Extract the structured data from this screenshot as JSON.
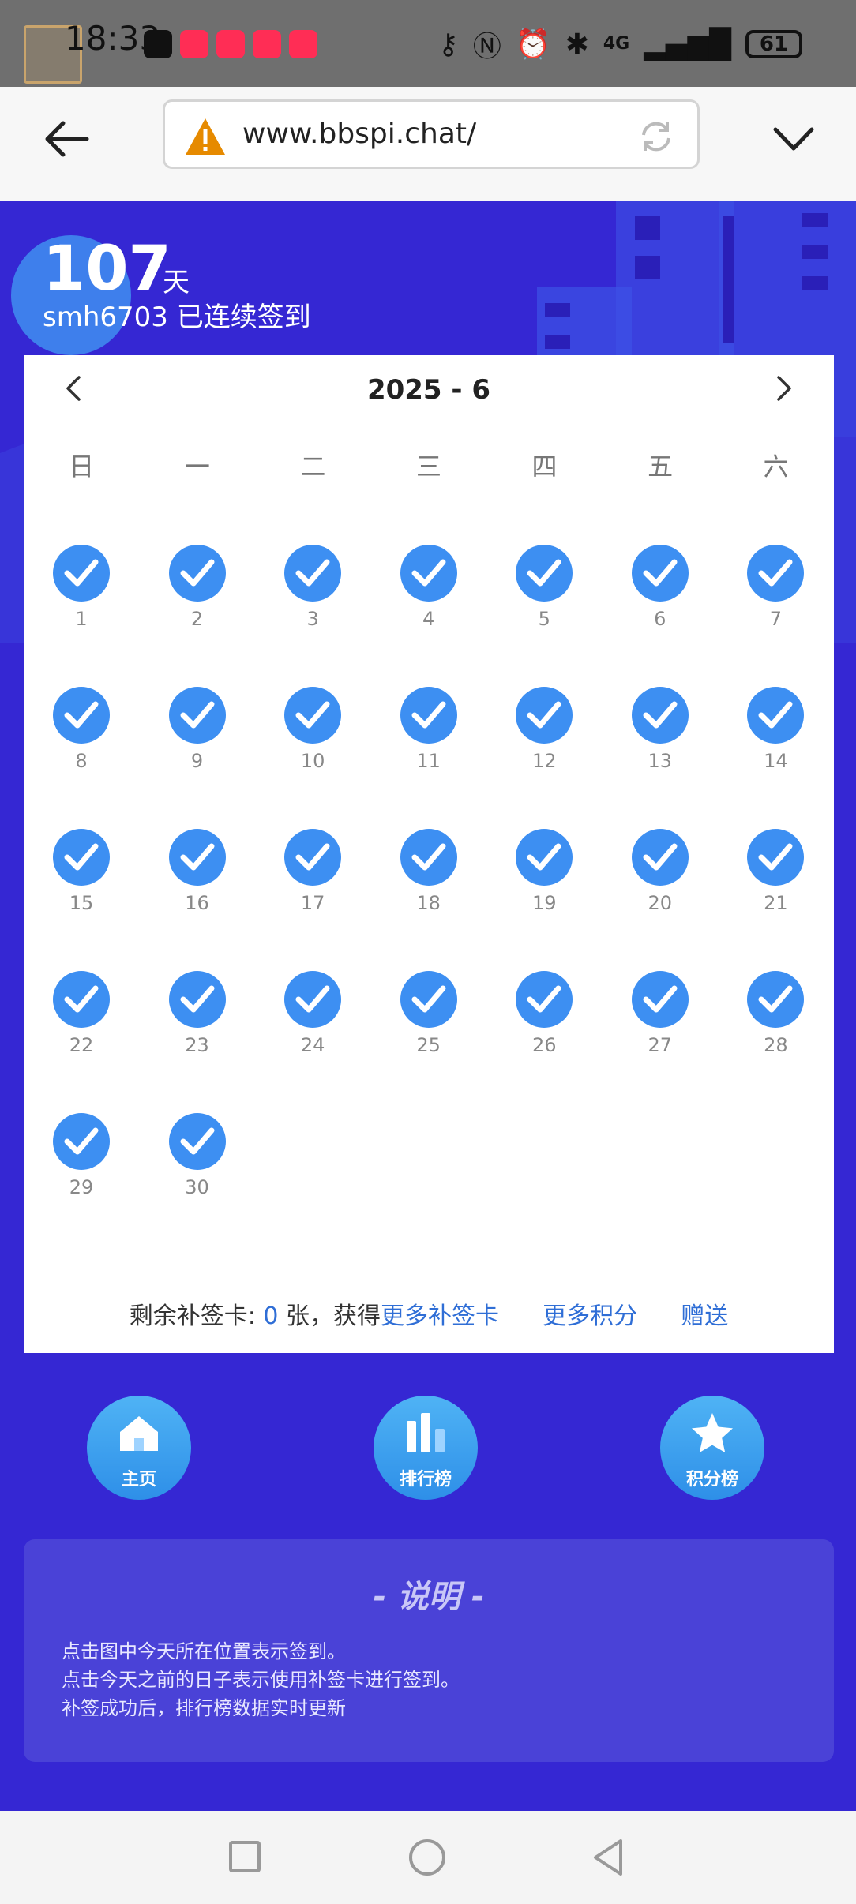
{
  "status_bar": {
    "time": "18:33",
    "network": "4G",
    "battery": "61",
    "app_icons": [
      "tiktok-app-icon",
      "xiaohongshu-app-icon",
      "xiaohongshu-app-icon",
      "xiaohongshu-app-icon",
      "xiaohongshu-app-icon"
    ]
  },
  "browser": {
    "url": "www.bbspi.chat/",
    "icons": [
      "back-arrow-icon",
      "warning-icon",
      "reload-icon",
      "chevron-down-icon"
    ]
  },
  "header": {
    "days": "107",
    "days_unit": "天",
    "streak_text": "smh6703 已连续签到"
  },
  "calendar": {
    "title": "2025 - 6",
    "weekdays": [
      "日",
      "一",
      "二",
      "三",
      "四",
      "五",
      "六"
    ],
    "days": [
      "1",
      "2",
      "3",
      "4",
      "5",
      "6",
      "7",
      "8",
      "9",
      "10",
      "11",
      "12",
      "13",
      "14",
      "15",
      "16",
      "17",
      "18",
      "19",
      "20",
      "21",
      "22",
      "23",
      "24",
      "25",
      "26",
      "27",
      "28",
      "29",
      "30"
    ],
    "checked": true,
    "footer": {
      "prefix": "剩余补签卡:",
      "count": "0",
      "suffix": "张，获得",
      "link_more_cards": "更多补签卡",
      "link_more_points": "更多积分",
      "link_gift": "赠送"
    }
  },
  "nav_buttons": {
    "home": "主页",
    "rank": "排行榜",
    "points": "积分榜"
  },
  "description": {
    "title": "- 说明 -",
    "lines": [
      "点击图中今天所在位置表示签到。",
      "点击今天之前的日子表示使用补签卡进行签到。",
      "补签成功后，排行榜数据实时更新"
    ]
  },
  "colors": {
    "primary_bg": "#3527d3",
    "check_blue": "#3d8ff2",
    "link_blue": "#2f6ed6",
    "warning": "#e68a00"
  }
}
